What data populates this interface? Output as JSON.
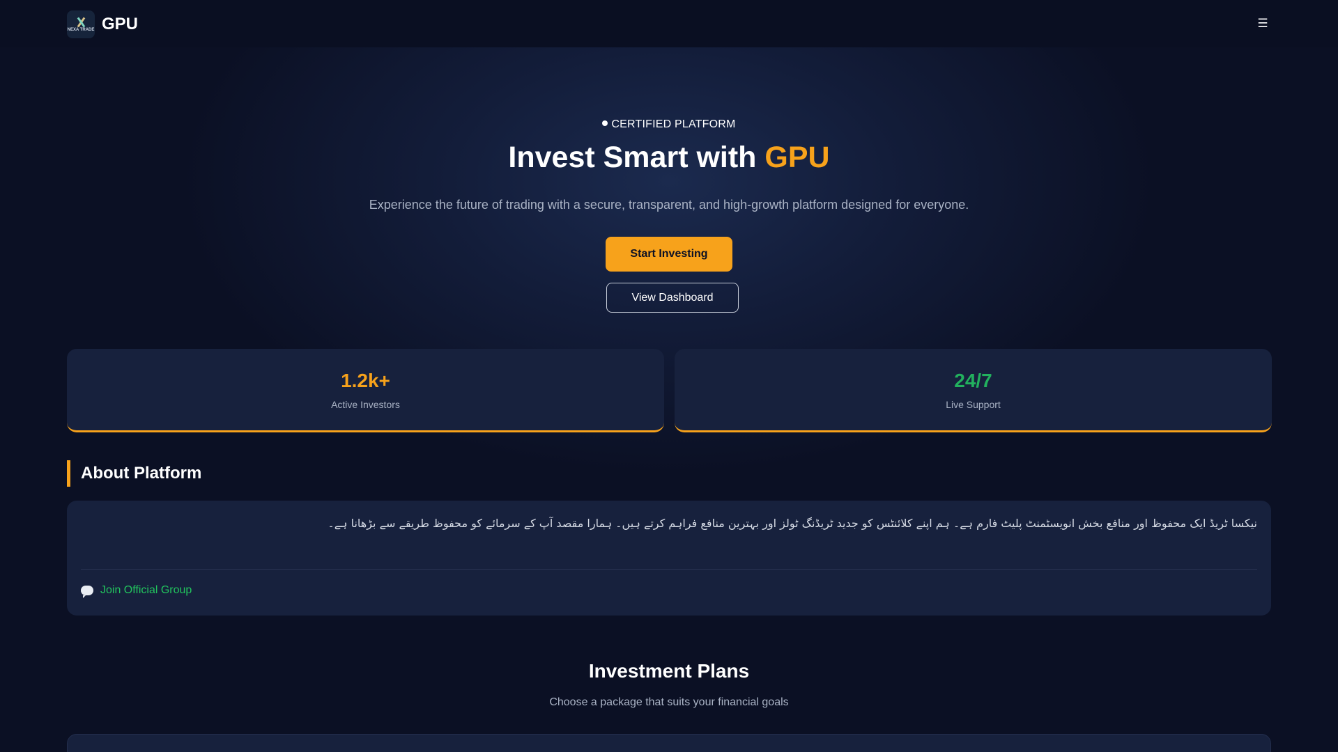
{
  "header": {
    "brand_name": "GPU",
    "logo_text": "NEXA TRADE",
    "menu_icon": "☰"
  },
  "hero": {
    "badge": "CERTIFIED PLATFORM",
    "title_prefix": "Invest Smart with ",
    "title_accent": "GPU",
    "subtitle": "Experience the future of trading with a secure, transparent, and high-growth platform designed for everyone.",
    "primary_button": "Start Investing",
    "secondary_button": "View Dashboard"
  },
  "stats": [
    {
      "value": "1.2k+",
      "label": "Active Investors"
    },
    {
      "value": "24/7",
      "label": "Live Support"
    }
  ],
  "about": {
    "heading": "About Platform",
    "text": "نیکسا ٹریڈ ایک محفوظ اور منافع بخش انویسٹمنٹ پلیٹ فارم ہے۔ ہم اپنے کلائنٹس کو جدید ٹریڈنگ ٹولز اور بہترین منافع فراہم کرتے ہیں۔ ہمارا مقصد آپ کے سرمائے کو محفوظ طریقے سے بڑھانا ہے۔",
    "join_link": "Join Official Group"
  },
  "plans": {
    "title": "Investment Plans",
    "subtitle": "Choose a package that suits your financial goals"
  },
  "colors": {
    "accent": "#f7a21b",
    "success": "#22b15e",
    "background": "#0b1024",
    "card": "#17213d"
  }
}
